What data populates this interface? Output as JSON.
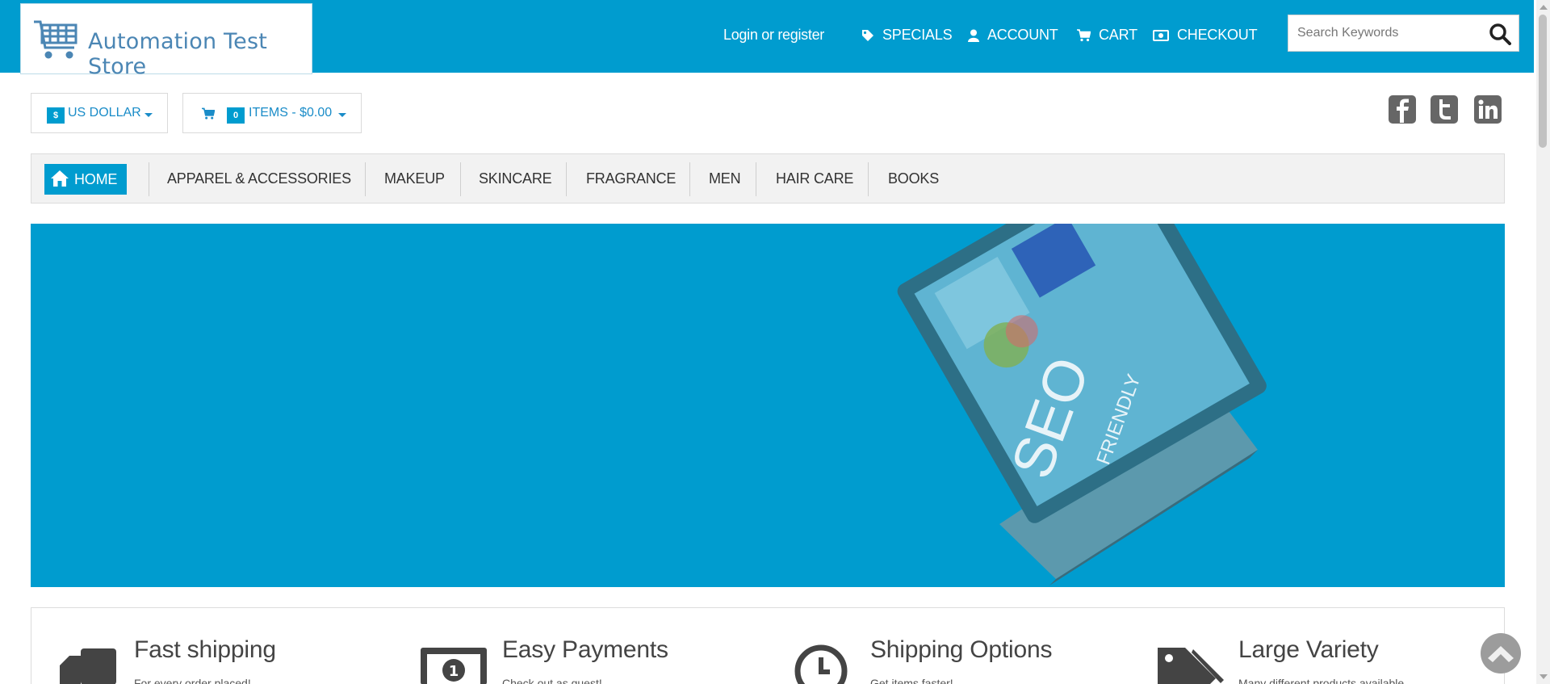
{
  "header": {
    "store_name": "Automation Test Store",
    "login_link": "Login or register",
    "nav": {
      "specials": "SPECIALS",
      "account": "ACCOUNT",
      "cart": "CART",
      "checkout": "CHECKOUT"
    },
    "search": {
      "placeholder": "Search Keywords",
      "value": ""
    }
  },
  "currency": {
    "symbol": "$",
    "label": "US DOLLAR"
  },
  "cart_summary": {
    "count": "0",
    "label": "ITEMS - $0.00"
  },
  "social": [
    "facebook-icon",
    "twitter-icon",
    "linkedin-icon"
  ],
  "menu": {
    "home": "HOME",
    "items": [
      "APPAREL & ACCESSORIES",
      "MAKEUP",
      "SKINCARE",
      "FRAGRANCE",
      "MEN",
      "HAIR CARE",
      "BOOKS"
    ]
  },
  "banner": {
    "text_line1": "SEO",
    "text_line2": "FRIENDLY"
  },
  "features": [
    {
      "icon": "truck-icon",
      "title": "Fast shipping",
      "subtitle": "For every order placed!"
    },
    {
      "icon": "money-icon",
      "title": "Easy Payments",
      "subtitle": "Check out as guest!"
    },
    {
      "icon": "clock-icon",
      "title": "Shipping Options",
      "subtitle": "Get items faster!"
    },
    {
      "icon": "tags-icon",
      "title": "Large Variety",
      "subtitle": "Many different products available"
    }
  ],
  "colors": {
    "brand": "#009ccf",
    "link": "#1a8cc8"
  }
}
